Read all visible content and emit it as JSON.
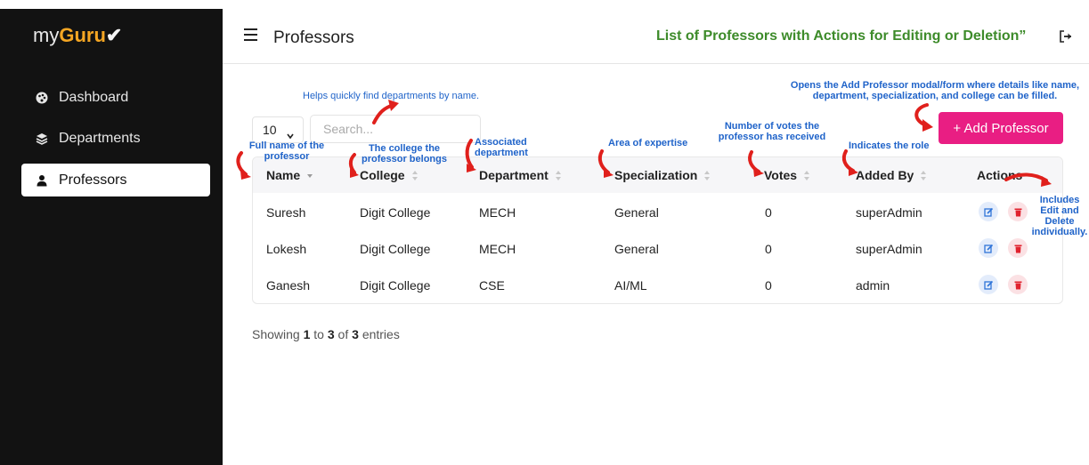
{
  "app": {
    "logo_prefix": "my",
    "logo_brand": "Guru",
    "logo_mark": "✔"
  },
  "sidebar": {
    "items": [
      {
        "label": "Dashboard",
        "icon": "palette-icon"
      },
      {
        "label": "Departments",
        "icon": "layers-icon"
      },
      {
        "label": "Professors",
        "icon": "user-tie-icon",
        "active": true
      }
    ]
  },
  "header": {
    "title": "Professors",
    "banner": "List of Professors with Actions for Editing or Deletion”"
  },
  "controls": {
    "page_length": "10",
    "search_placeholder": "Search...",
    "add_button": "+ Add Professor"
  },
  "table": {
    "columns": [
      "Name",
      "College",
      "Department",
      "Specialization",
      "Votes",
      "Added By",
      "Actions"
    ],
    "rows": [
      [
        "Suresh",
        "Digit College",
        "MECH",
        "General",
        "0",
        "superAdmin"
      ],
      [
        "Lokesh",
        "Digit College",
        "MECH",
        "General",
        "0",
        "superAdmin"
      ],
      [
        "Ganesh",
        "Digit College",
        "CSE",
        "AI/ML",
        "0",
        "admin"
      ]
    ]
  },
  "footer": {
    "showing": "Showing",
    "from": "1",
    "to_word": "to",
    "to": "3",
    "of_word": "of",
    "total": "3",
    "entries": "entries"
  },
  "annotations": {
    "search": "Helps quickly find departments by name.",
    "add": "Opens the Add Professor modal/form where details like name, department, specialization, and college can be filled.",
    "name": "Full name of the professor",
    "college": "The college the professor belongs",
    "department": "Associated department",
    "specialization": "Area of expertise",
    "votes": "Number of votes the professor has received",
    "added_by": "Indicates the role",
    "actions": "Includes Edit and Delete individually."
  },
  "colors": {
    "accent": "#e91e83",
    "sidebar": "#121212",
    "brand": "#f5a623",
    "banner": "#3d8b2a",
    "annotation": "#1f63c9",
    "arrow": "#e0201c"
  }
}
